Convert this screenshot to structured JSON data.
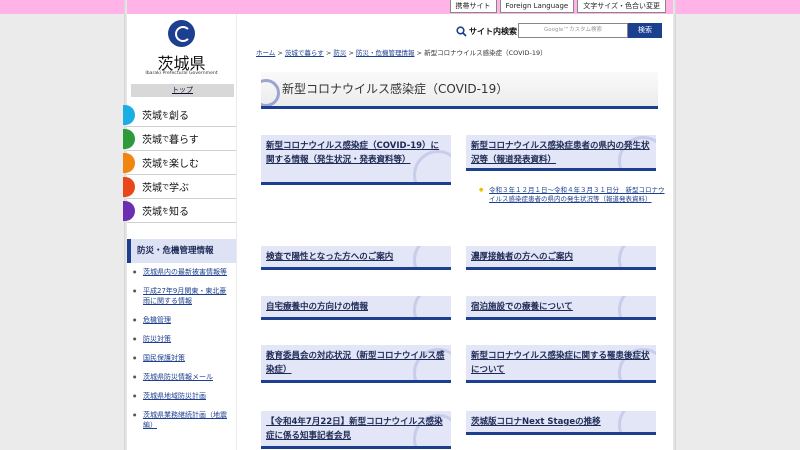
{
  "utility_links": [
    "携帯サイト",
    "Foreign Language",
    "文字サイズ・色合い変更"
  ],
  "logo": {
    "name": "茨城県",
    "sub": "Ibaraki Prefectural Government"
  },
  "top_link": "トップ",
  "nav": [
    {
      "pre": "茨城",
      "particle": "を",
      "post": "創る",
      "color": "#1aaee5"
    },
    {
      "pre": "茨城",
      "particle": "で",
      "post": "暮らす",
      "color": "#2e9b3a"
    },
    {
      "pre": "茨城",
      "particle": "を",
      "post": "楽しむ",
      "color": "#f0860f"
    },
    {
      "pre": "茨城",
      "particle": "で",
      "post": "学ぶ",
      "color": "#e8471c"
    },
    {
      "pre": "茨城",
      "particle": "を",
      "post": "知る",
      "color": "#6a2fb0"
    }
  ],
  "section_title": "防災・危機管理情報",
  "section_links": [
    "茨城県内の最新被害情報等",
    "平成27年9月関東・東北豪雨に関する情報",
    "危機管理",
    "防災対策",
    "国民保護対策",
    "茨城県防災情報メール",
    "茨城県地域防災計画",
    "茨城県業務継続計画（地震編）"
  ],
  "search": {
    "label": "サイト内検索",
    "placeholder": "Google™カスタム検索",
    "button": "検索"
  },
  "breadcrumb": [
    "ホーム",
    "茨城で暮らす",
    "防災",
    "防災・危機管理情報",
    "新型コロナウイルス感染症（COVID-19）"
  ],
  "page_title": "新型コロナウイルス感染症（COVID-19）",
  "cards": [
    "新型コロナウイルス感染症（COVID-19）に関する情報（発生状況・発表資料等）",
    "新型コロナウイルス感染症患者の県内の発生状況等（報道発表資料）",
    "検査で陽性となった方へのご案内",
    "濃厚接触者の方へのご案内",
    "自宅療養中の方向けの情報",
    "宿泊施設での療養について",
    "教育委員会の対応状況（新型コロナウイルス感染症）",
    "新型コロナウイルス感染症に関する罹患後症状について",
    "【令和4年7月22日】新型コロナウイルス感染症に係る知事記者会見",
    "茨城版コロナNext Stageの推移"
  ],
  "card_sublink": "令和３年１２月１日〜令和４年３月３１日分　新型コロナウイルス感染症患者の県内の発生状況等（報道発表資料）"
}
